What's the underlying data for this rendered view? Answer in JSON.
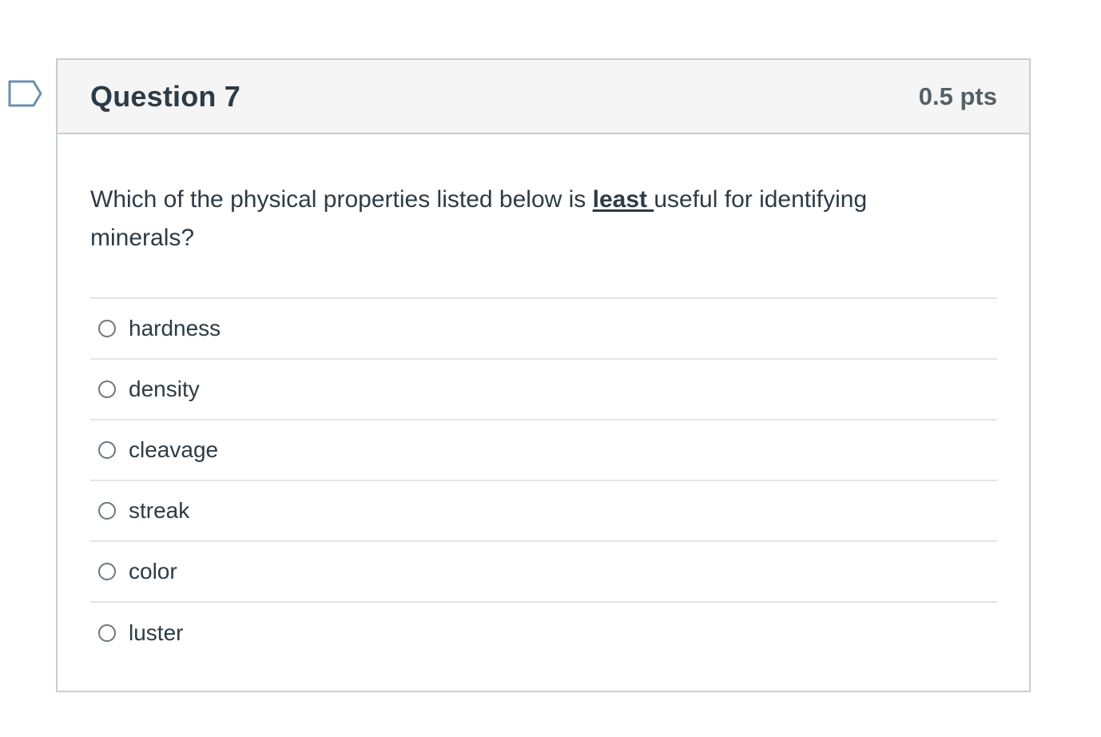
{
  "question": {
    "title": "Question 7",
    "points": "0.5 pts",
    "text_before": "Which of the physical properties listed below is ",
    "text_emphasis": "least ",
    "text_after": "useful for identifying minerals?"
  },
  "answers": [
    {
      "label": "hardness"
    },
    {
      "label": "density"
    },
    {
      "label": "cleavage"
    },
    {
      "label": "streak"
    },
    {
      "label": "color"
    },
    {
      "label": "luster"
    }
  ],
  "colors": {
    "header_bg": "#f5f5f5",
    "border": "#c7cdd1",
    "text": "#2d3b45",
    "points_text": "#555f66",
    "flag_outline": "#6b8fb0"
  }
}
